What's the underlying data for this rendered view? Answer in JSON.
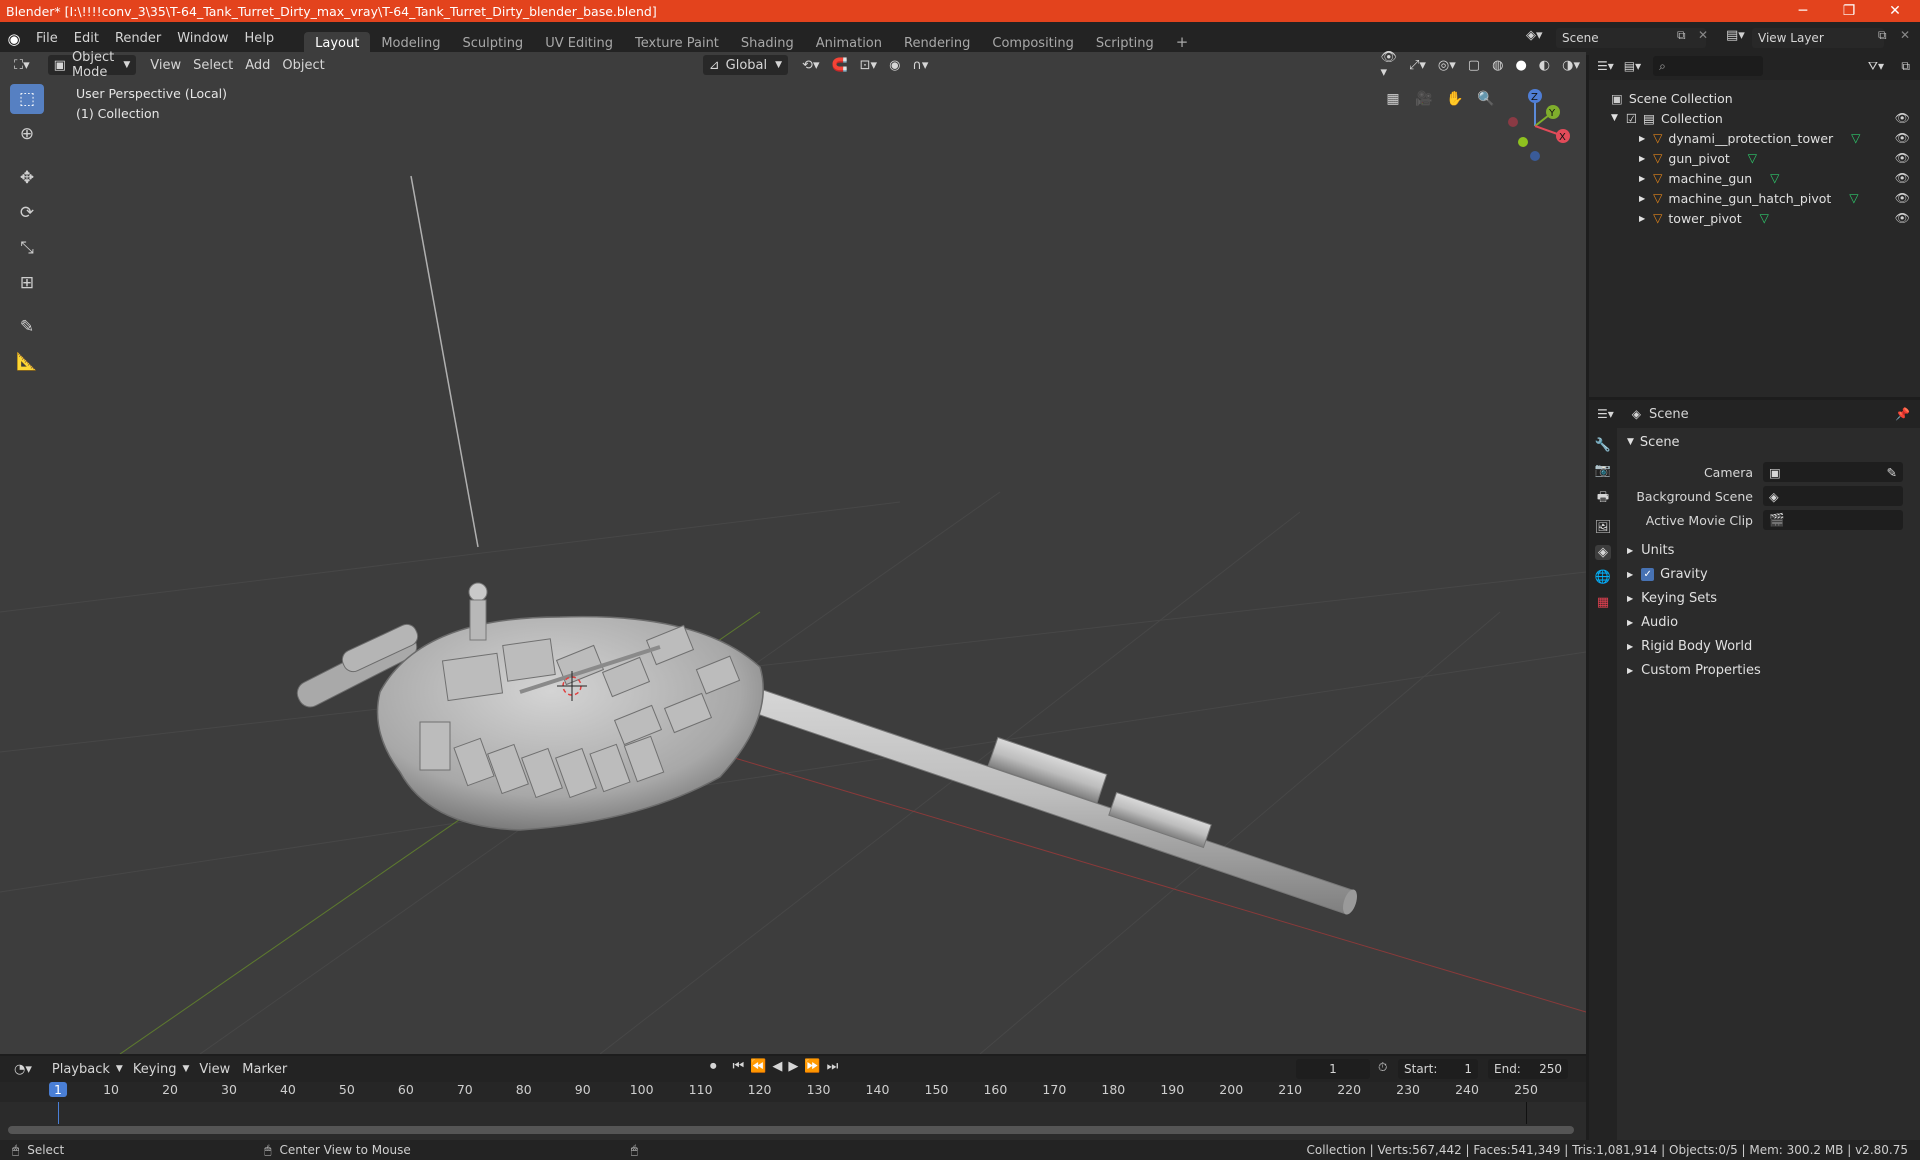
{
  "window": {
    "title": "Blender* [I:\\!!!!conv_3\\35\\T-64_Tank_Turret_Dirty_max_vray\\T-64_Tank_Turret_Dirty_blender_base.blend]",
    "controls": [
      "─",
      "❐",
      "✕"
    ]
  },
  "menu": [
    "File",
    "Edit",
    "Render",
    "Window",
    "Help"
  ],
  "workspaces": [
    {
      "label": "Layout",
      "active": true
    },
    {
      "label": "Modeling",
      "active": false
    },
    {
      "label": "Sculpting",
      "active": false
    },
    {
      "label": "UV Editing",
      "active": false
    },
    {
      "label": "Texture Paint",
      "active": false
    },
    {
      "label": "Shading",
      "active": false
    },
    {
      "label": "Animation",
      "active": false
    },
    {
      "label": "Rendering",
      "active": false
    },
    {
      "label": "Compositing",
      "active": false
    },
    {
      "label": "Scripting",
      "active": false
    }
  ],
  "scene_field": "Scene",
  "view_layer_field": "View Layer",
  "viewport": {
    "mode": "Object Mode",
    "menus": [
      "View",
      "Select",
      "Add",
      "Object"
    ],
    "orientation": "Global",
    "overlay_text": [
      "User Perspective (Local)",
      "(1) Collection"
    ],
    "gizmo": {
      "z": "Z",
      "y": "Y",
      "x": "X"
    }
  },
  "outliner": {
    "root": "Scene Collection",
    "collection": "Collection",
    "items": [
      {
        "name": "dynami__protection_tower",
        "has_data": true
      },
      {
        "name": "gun_pivot",
        "has_data": true
      },
      {
        "name": "machine_gun",
        "has_data": true
      },
      {
        "name": "machine_gun_hatch_pivot",
        "has_data": true
      },
      {
        "name": "tower_pivot",
        "has_data": true
      }
    ]
  },
  "properties": {
    "header": "Scene",
    "panel": "Scene",
    "fields": [
      {
        "label": "Camera",
        "value": ""
      },
      {
        "label": "Background Scene",
        "value": ""
      },
      {
        "label": "Active Movie Clip",
        "value": ""
      }
    ],
    "subpanels": [
      {
        "label": "Units",
        "checkbox": false
      },
      {
        "label": "Gravity",
        "checkbox": true
      },
      {
        "label": "Keying Sets",
        "checkbox": false
      },
      {
        "label": "Audio",
        "checkbox": false
      },
      {
        "label": "Rigid Body World",
        "checkbox": false
      },
      {
        "label": "Custom Properties",
        "checkbox": false
      }
    ]
  },
  "timeline": {
    "menus": [
      "Playback",
      "Keying",
      "View",
      "Marker"
    ],
    "current_frame": "1",
    "start_label": "Start:",
    "start": "1",
    "end_label": "End:",
    "end": "250",
    "ticks": [
      "1",
      "10",
      "20",
      "30",
      "40",
      "50",
      "60",
      "70",
      "80",
      "90",
      "100",
      "110",
      "120",
      "130",
      "140",
      "150",
      "160",
      "170",
      "180",
      "190",
      "200",
      "210",
      "220",
      "230",
      "240",
      "250"
    ]
  },
  "status": {
    "left": "Select",
    "middle": "Center View to Mouse",
    "right": "Collection | Verts:567,442 | Faces:541,349 | Tris:1,081,914 | Objects:0/5 | Mem: 300.2 MB | v2.80.75"
  }
}
